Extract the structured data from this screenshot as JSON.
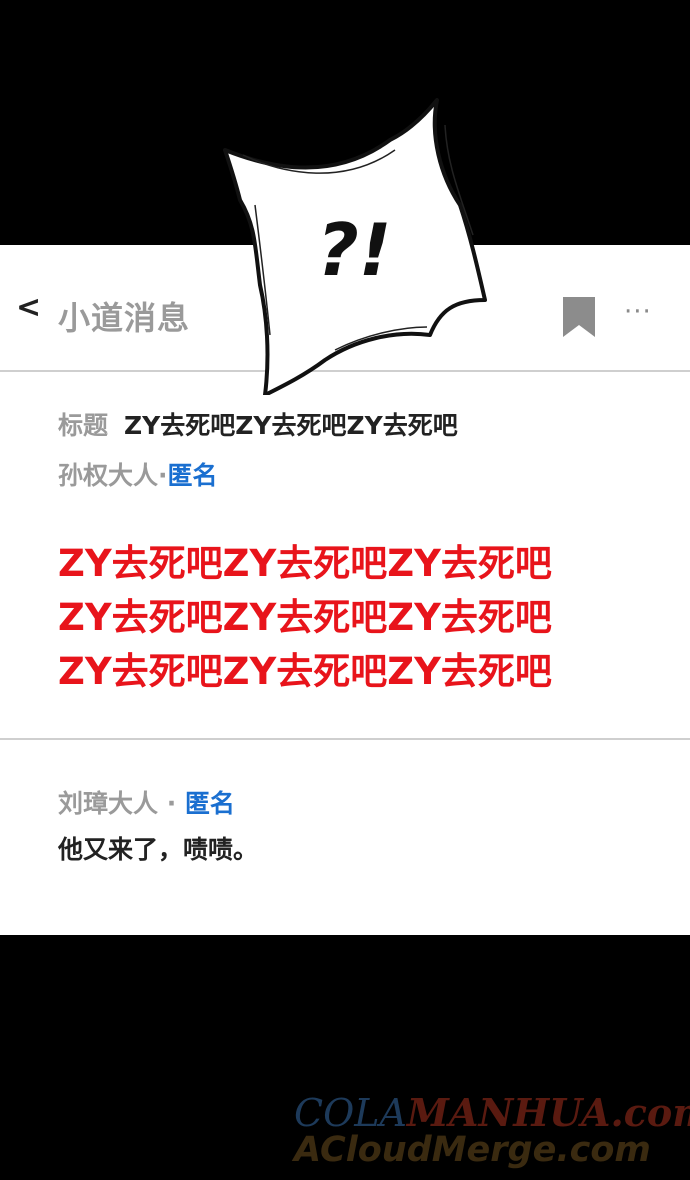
{
  "header": {
    "back_label": "<",
    "title": "小道消息",
    "bookmark_icon": "bookmark-icon",
    "more_label": "···"
  },
  "post": {
    "title_label": "标题",
    "title": "ZY去死吧ZY去死吧ZY去死吧",
    "author": "孙权大人·",
    "anon_tag": "匿名",
    "body_lines": [
      "ZY去死吧ZY去死吧ZY去死吧",
      "ZY去死吧ZY去死吧ZY去死吧",
      "ZY去死吧ZY去死吧ZY去死吧"
    ],
    "body_color": "#e8141b"
  },
  "reply": {
    "author": "刘璋大人 · ",
    "anon_tag": "匿名",
    "text": "他又来了，啧啧。"
  },
  "overlay": {
    "exclamation": "?!"
  },
  "watermark": {
    "part1": "COLA",
    "part2": "MANHUA",
    "part3": ".com",
    "line2": "ACloudMerge.com"
  },
  "colors": {
    "accent_blue": "#1a6fd0",
    "gray_text": "#9a9a9a",
    "dark_text": "#222222"
  }
}
